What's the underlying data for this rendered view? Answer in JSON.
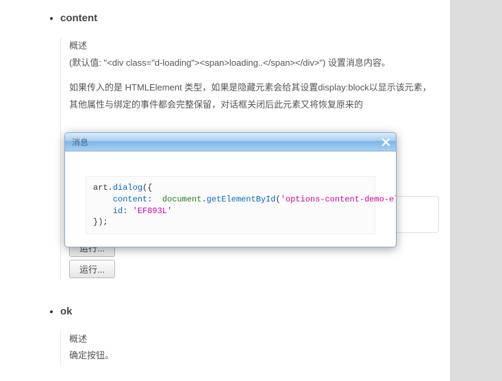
{
  "sections": {
    "content": {
      "title": "content",
      "overview_label": "概述",
      "desc": "(默认值: \"<div class=\"d-loading\"><span>loading..</span></div>\") 设置消息内容。",
      "para1": "如果传入的是 HTMLElement 类型，如果是隐藏元素会给其设置display:block以显示该元素，其他属性与绑定的事件都会完整保留，对话框关闭后此元素又将恢复原来的",
      "run_label_1": "运行...",
      "run_label_2": "运行..."
    },
    "ok": {
      "title": "ok",
      "overview_label": "概述",
      "desc": "确定按钮。"
    }
  },
  "dialog": {
    "title": "消息",
    "code": {
      "p0": "art.",
      "p1": "dialog",
      "p2": "({",
      "p3": "    content",
      "p4": ":  ",
      "p5": "document",
      "p6": ".",
      "p7": "getElementById",
      "p8": "(",
      "p9": "'options-content-demo-element'",
      "p10": "),",
      "p11": "    id",
      "p12": ": ",
      "p13": "'EF893L'",
      "p14": "});"
    }
  }
}
